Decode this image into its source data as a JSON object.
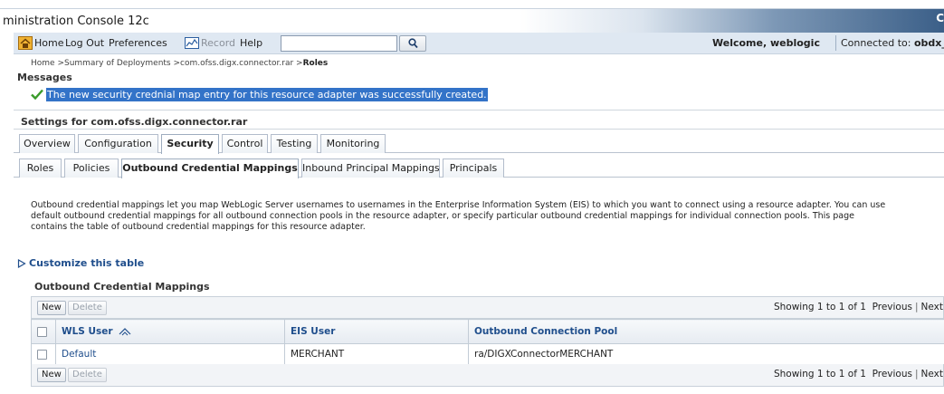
{
  "window": {
    "title": "ministration Console 12c",
    "corner_text": "C"
  },
  "toolbar": {
    "home": "Home",
    "logout": "Log Out",
    "preferences": "Preferences",
    "record": "Record",
    "help": "Help",
    "search_value": "",
    "welcome": "Welcome, weblogic",
    "connected_label": "Connected to:",
    "connected_value": "obdx_xa"
  },
  "breadcrumb": {
    "items": [
      "Home",
      "Summary of Deployments",
      "com.ofss.digx.connector.rar"
    ],
    "separator": " >",
    "current": "Roles"
  },
  "messages": {
    "heading": "Messages",
    "success_text": "The new security crednial map entry for this resource adapter was successfully created."
  },
  "settings": {
    "title": "Settings for com.ofss.digx.connector.rar"
  },
  "tabs": [
    {
      "label": "Overview"
    },
    {
      "label": "Configuration"
    },
    {
      "label": "Security"
    },
    {
      "label": "Control"
    },
    {
      "label": "Testing"
    },
    {
      "label": "Monitoring"
    }
  ],
  "subtabs": [
    {
      "label": "Roles"
    },
    {
      "label": "Policies"
    },
    {
      "label": "Outbound Credential Mappings"
    },
    {
      "label": "Inbound Principal Mappings"
    },
    {
      "label": "Principals"
    }
  ],
  "description": {
    "line1": "Outbound credential mappings let you map WebLogic Server usernames to usernames in the Enterprise Information System (EIS) to which you want to connect using a resource adapter. You can use",
    "line2": "default outbound credential mappings for all outbound connection pools in the resource adapter, or specify particular outbound credential mappings for individual connection pools. This page",
    "line3": "contains the table of outbound credential mappings for this resource adapter."
  },
  "customize_link": "Customize this table",
  "table": {
    "caption": "Outbound Credential Mappings",
    "buttons": {
      "new": "New",
      "delete": "Delete"
    },
    "paging": {
      "showing": "Showing 1 to 1 of 1",
      "previous": "Previous",
      "next": "Next"
    },
    "columns": [
      "WLS User",
      "EIS User",
      "Outbound Connection Pool"
    ],
    "rows": [
      {
        "wls_user": "Default",
        "eis_user": "MERCHANT",
        "pool": "ra/DIGXConnectorMERCHANT"
      }
    ]
  },
  "colors": {
    "link": "#1f4e8c",
    "selection": "#3373c8",
    "toolbar": "#dfe8f2"
  }
}
